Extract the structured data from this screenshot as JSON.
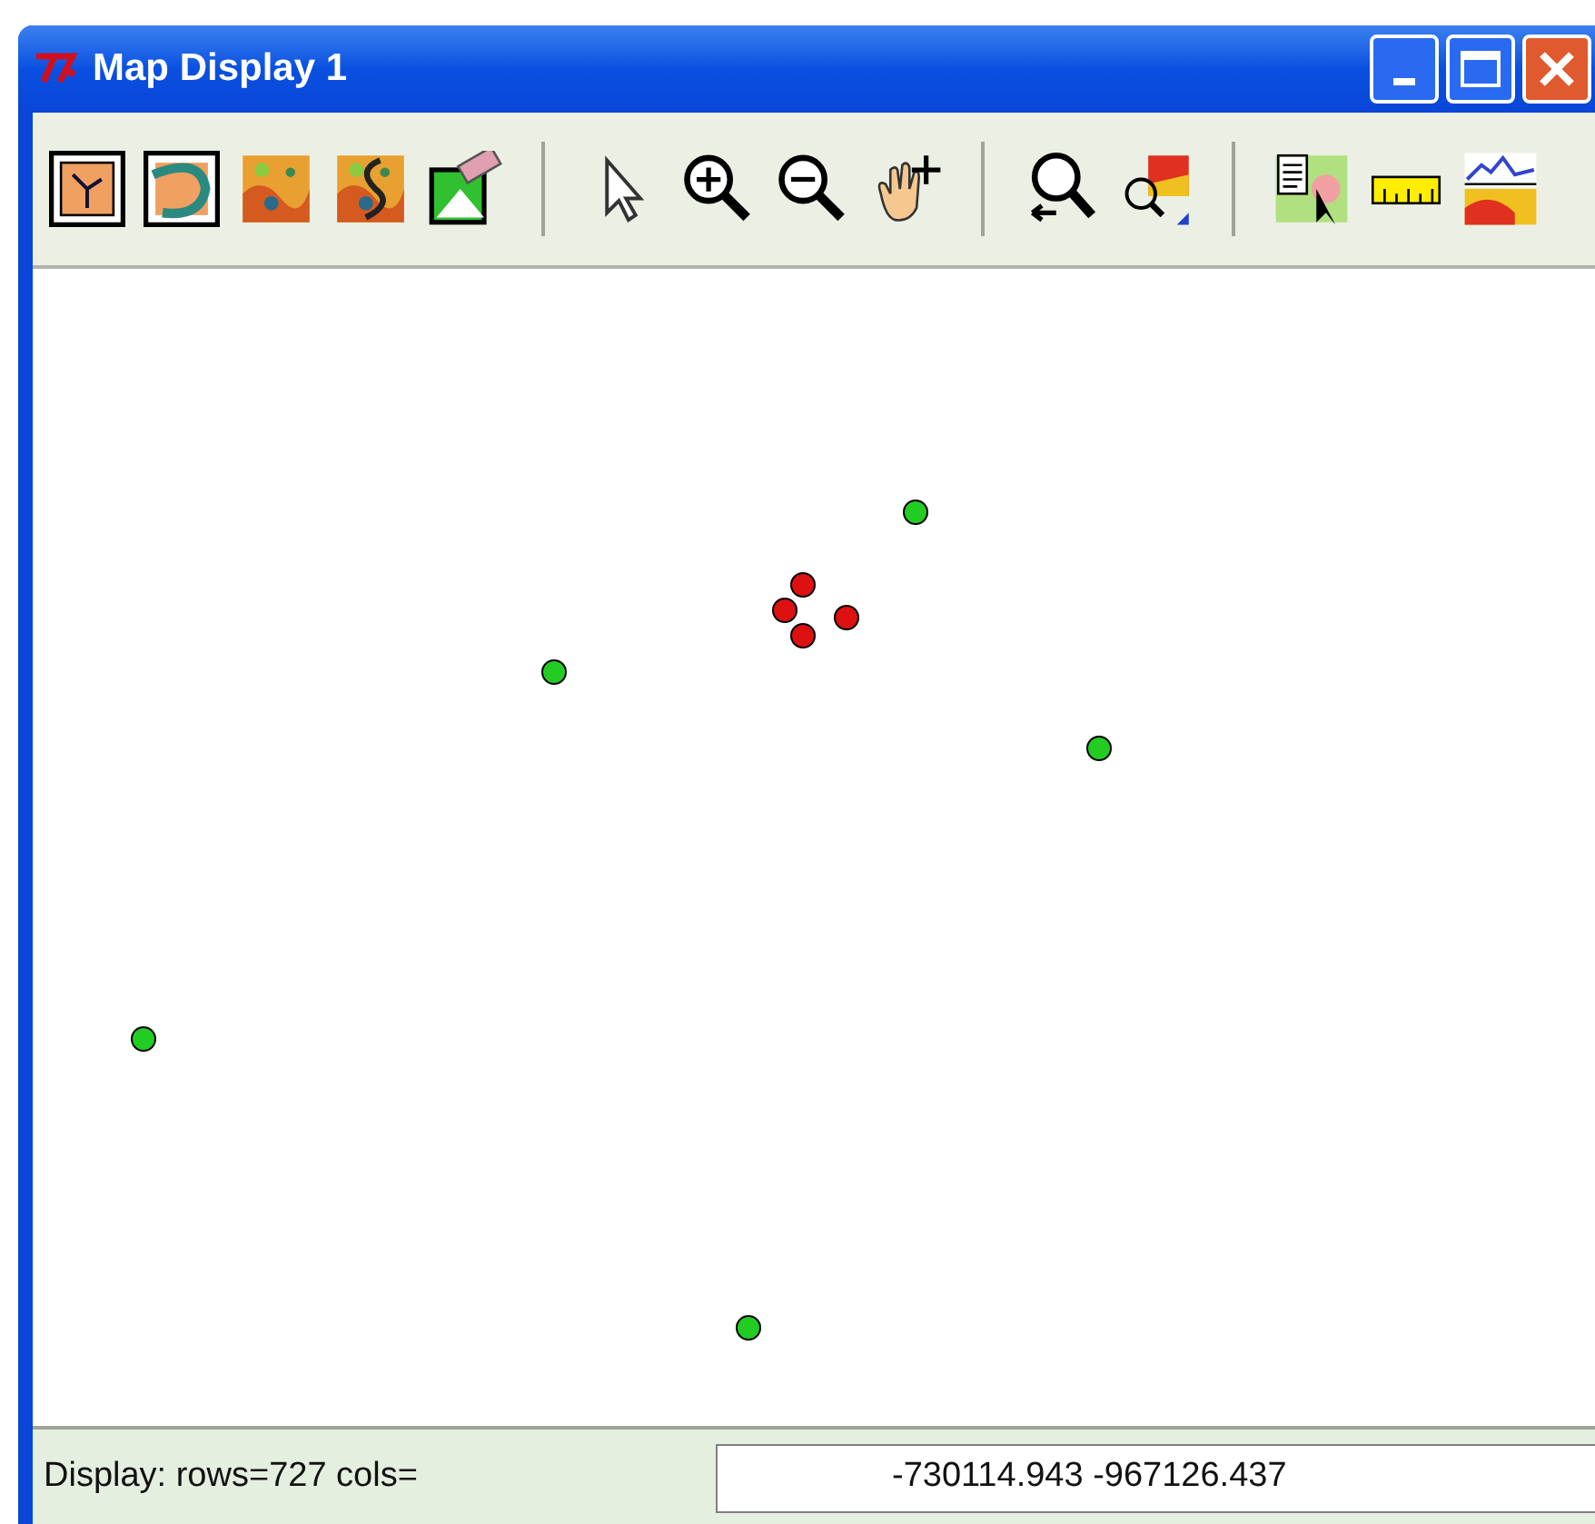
{
  "window": {
    "title": "Map Display 1"
  },
  "map": {
    "points": [
      {
        "color": "#22cc22"
      },
      {
        "color": "#22cc22"
      },
      {
        "color": "#22cc22"
      },
      {
        "color": "#22cc22"
      },
      {
        "color": "#22cc22"
      },
      {
        "color": "#dd1111"
      },
      {
        "color": "#dd1111"
      },
      {
        "color": "#dd1111"
      },
      {
        "color": "#dd1111"
      }
    ]
  },
  "status_bar": {
    "label": "Display: rows=727 cols=",
    "coordinates": "-730114.943 -967126.437"
  }
}
